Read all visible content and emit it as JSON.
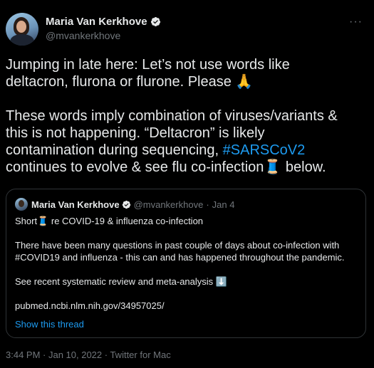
{
  "author": {
    "display_name": "Maria Van Kerkhove",
    "handle": "@mvankerkhove"
  },
  "tweet": {
    "line1": "Jumping in late here: Let’s not use words like",
    "line2": "deltacron, flurona or flurone. Please 🙏",
    "line3": "These words imply combination of viruses/variants &",
    "line4": "this is not happening. “Deltacron” is likely",
    "line5_prefix": "contamination during sequencing, ",
    "hashtag": "#SARSCoV2",
    "line6": "continues to evolve & see flu co-infection🧵 below."
  },
  "quoted_tweet": {
    "display_name": "Maria Van Kerkhove",
    "handle": "@mvankerkhove",
    "separator": "·",
    "date": "Jan 4",
    "line1": "Short🧵 re COVID-19 & influenza co-infection",
    "line2": "There have been many questions in past couple of days about co-infection with",
    "line3": "#COVID19 and influenza - this can and has happened throughout the pandemic.",
    "line4": "See recent systematic review and meta-analysis ⬇️",
    "line5": "pubmed.ncbi.nlm.nih.gov/34957025/",
    "show_thread": "Show this thread"
  },
  "meta": {
    "text": "3:44 PM · Jan 10, 2022 · Twitter for Mac"
  },
  "icons": {
    "verified": "verified-badge-icon",
    "more": "more-options-icon"
  },
  "colors": {
    "background": "#000000",
    "text": "#e7e9ea",
    "muted": "#71767b",
    "link": "#1d9bf0",
    "border": "#2f3336"
  }
}
